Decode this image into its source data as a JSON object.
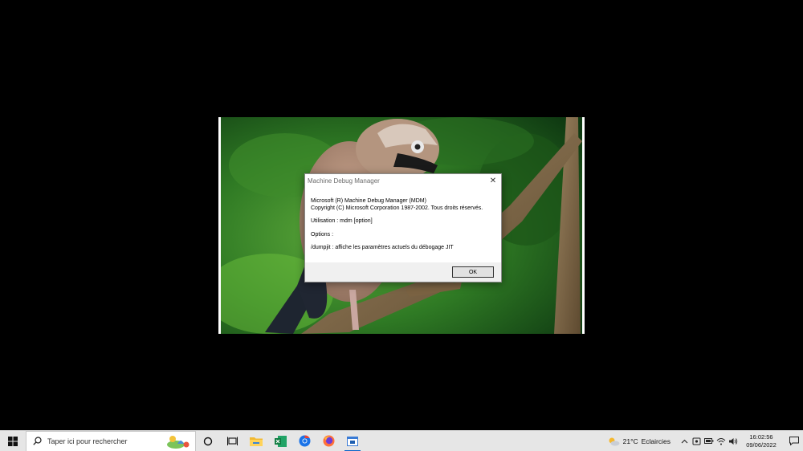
{
  "dialog": {
    "title": "Machine Debug Manager",
    "lines": [
      "Microsoft (R) Machine Debug Manager (MDM)",
      "Copyright (C) Microsoft Corporation 1987-2002. Tous droits réservés.",
      "Utilisation : mdm [option]",
      "Options :",
      "/dumpjit : affiche les paramètres actuels du débogage JIT"
    ],
    "ok_label": "OK"
  },
  "taskbar": {
    "search_placeholder": "Taper ici pour rechercher",
    "pinned_apps": [
      "task-view",
      "file-explorer",
      "excel",
      "chrome",
      "firefox",
      "mdm-app"
    ],
    "weather": {
      "temperature": "21°C",
      "description": "Eclaircies"
    },
    "clock": {
      "time": "16:02:56",
      "date": "09/06/2022"
    }
  },
  "colors": {
    "taskbar_bg": "#e6e6e6",
    "dialog_footer": "#f0f0f0",
    "accent": "#0a64c8"
  }
}
